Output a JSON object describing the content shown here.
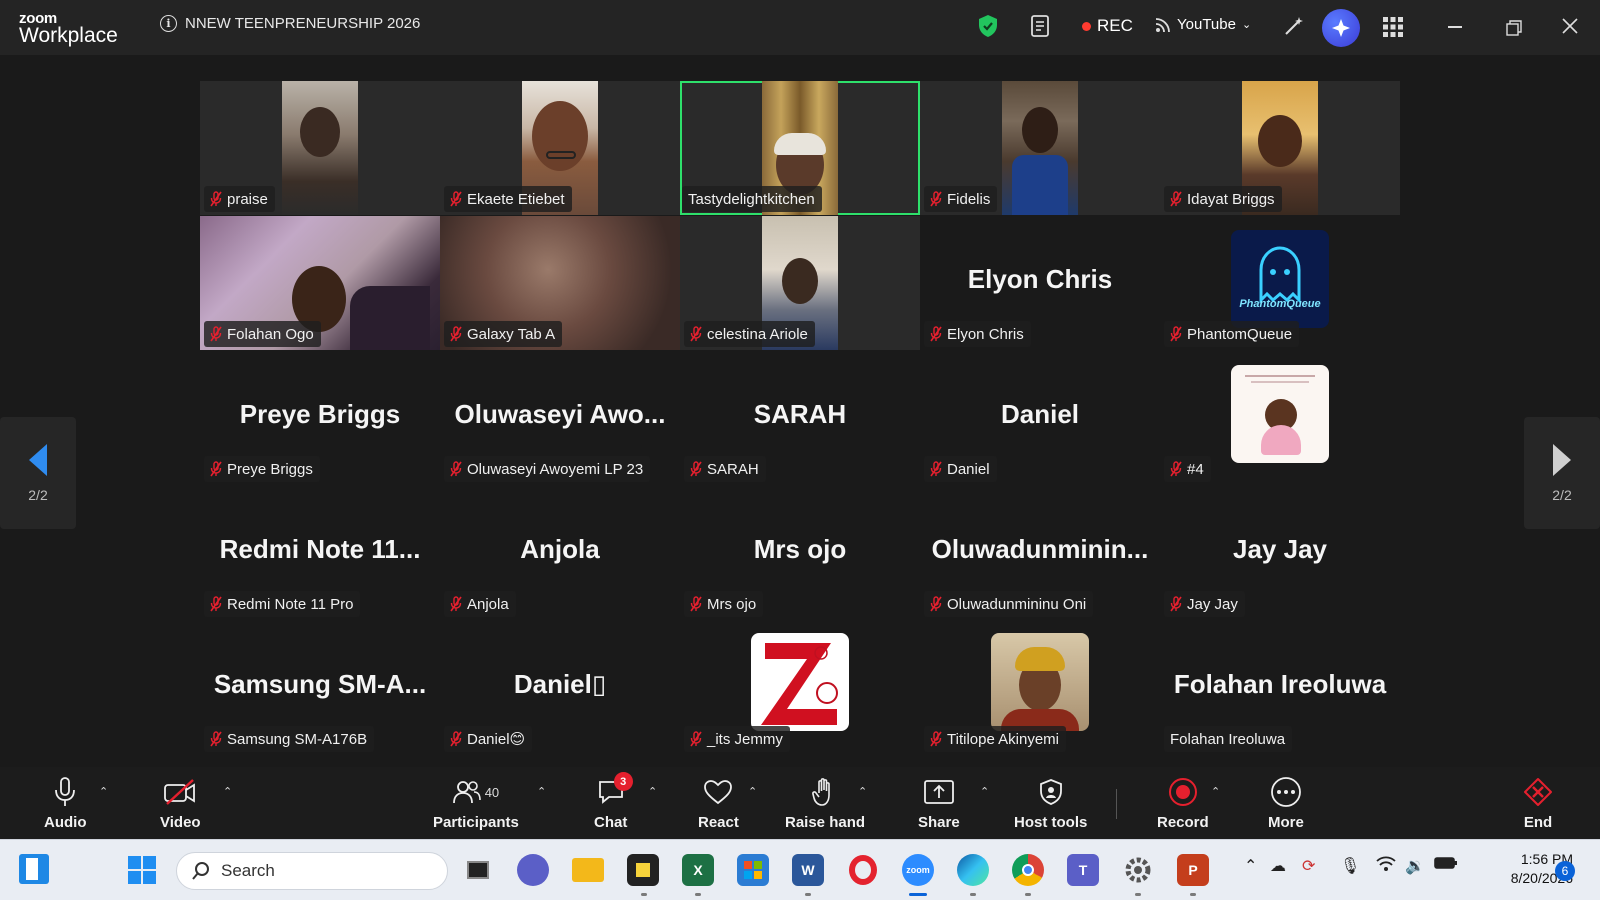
{
  "app": {
    "logo_top": "zoom",
    "logo_bottom": "Workplace"
  },
  "meeting": {
    "title": "NNEW TEENPRENEURSHIP 2026"
  },
  "topbar": {
    "rec_label": "REC",
    "stream_label": "YouTube"
  },
  "gallery": {
    "page_left": "2/2",
    "page_right": "2/2",
    "tiles": [
      {
        "name": "praise",
        "big": ""
      },
      {
        "name": "Ekaete Etiebet",
        "big": ""
      },
      {
        "name": "Tastydelightkitchen",
        "big": ""
      },
      {
        "name": "Fidelis",
        "big": ""
      },
      {
        "name": "Idayat Briggs",
        "big": ""
      },
      {
        "name": "Folahan Ogo",
        "big": ""
      },
      {
        "name": "Galaxy Tab A",
        "big": ""
      },
      {
        "name": "celestina Ariole",
        "big": ""
      },
      {
        "name": "Elyon Chris",
        "big": "Elyon Chris"
      },
      {
        "name": "PhantomQueue",
        "big": ""
      },
      {
        "name": "Preye Briggs",
        "big": "Preye Briggs"
      },
      {
        "name": "Oluwaseyi Awoyemi LP 23",
        "big": "Oluwaseyi  Awo..."
      },
      {
        "name": "SARAH",
        "big": "SARAH"
      },
      {
        "name": "Daniel",
        "big": "Daniel"
      },
      {
        "name": "#4",
        "big": ""
      },
      {
        "name": "Redmi Note 11 Pro",
        "big": "Redmi  Note  11..."
      },
      {
        "name": "Anjola",
        "big": "Anjola"
      },
      {
        "name": "Mrs ojo",
        "big": "Mrs ojo"
      },
      {
        "name": "Oluwadunmininu Oni",
        "big": "Oluwadunminin..."
      },
      {
        "name": "Jay Jay",
        "big": "Jay Jay"
      },
      {
        "name": "Samsung SM-A176B",
        "big": "Samsung  SM-A..."
      },
      {
        "name": "Daniel😊",
        "big": "Daniel▯"
      },
      {
        "name": "_its Jemmy",
        "big": ""
      },
      {
        "name": "Titilope Akinyemi",
        "big": ""
      },
      {
        "name": "Folahan Ireoluwa",
        "big": "Folahan Ireoluwa"
      }
    ],
    "phantom_avatar_text": "PhantomQueue"
  },
  "controls": {
    "audio": "Audio",
    "video": "Video",
    "participants": "Participants",
    "participants_count": "40",
    "chat": "Chat",
    "chat_badge": "3",
    "react": "React",
    "raise_hand": "Raise hand",
    "share": "Share",
    "host_tools": "Host tools",
    "record": "Record",
    "more": "More",
    "end": "End"
  },
  "taskbar": {
    "search_placeholder": "Search",
    "time": "1:56 PM",
    "date": "8/20/2026",
    "notifications": "6"
  },
  "colors": {
    "active_speaker": "#2ee06b",
    "mute_red": "#e5202e",
    "record_red": "#e5202e",
    "ai_blue": "#4a5cf0"
  }
}
